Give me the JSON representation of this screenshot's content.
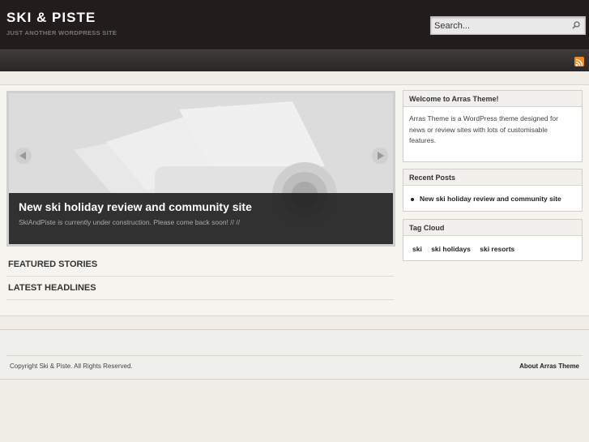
{
  "header": {
    "site_title": "SKI & PISTE",
    "site_description": "JUST ANOTHER WORDPRESS SITE",
    "search_placeholder": "Search...",
    "search_icon": "search-icon"
  },
  "navbar": {
    "feed_icon": "rss-icon",
    "accent_color": "#f08a24"
  },
  "slider": {
    "title": "New ski holiday review and community site",
    "text": "SkiAndPiste is currently under construction. Please come back soon! // //",
    "prev_icon": "chevron-left-icon",
    "next_icon": "chevron-right-icon"
  },
  "sections": {
    "featured": "FEATURED STORIES",
    "latest": "LATEST HEADLINES"
  },
  "sidebar": {
    "welcome": {
      "title": "Welcome to Arras Theme!",
      "text": "Arras Theme is a WordPress theme designed for news or review sites with lots of customisable features."
    },
    "recent_posts": {
      "title": "Recent Posts",
      "items": [
        "New ski holiday review and community site"
      ]
    },
    "tag_cloud": {
      "title": "Tag Cloud",
      "tags": [
        "ski",
        "ski holidays",
        "ski resorts"
      ]
    }
  },
  "footer": {
    "copyright": "Copyright Ski & Piste. All Rights Reserved.",
    "about_link": "About Arras Theme"
  }
}
